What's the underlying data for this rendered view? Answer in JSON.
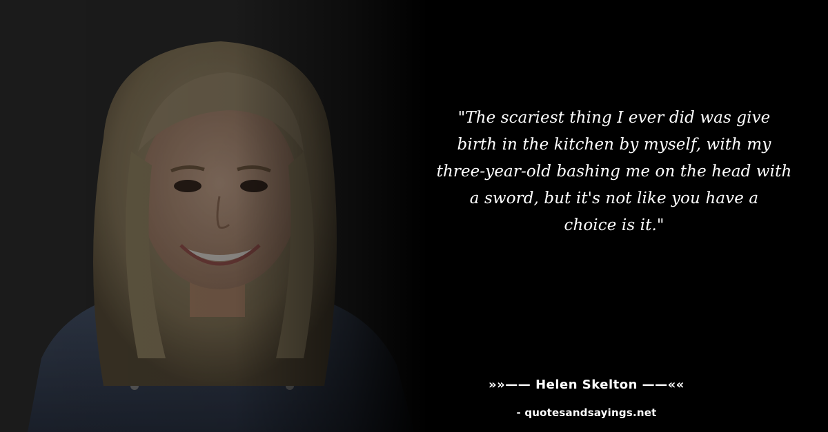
{
  "quote": {
    "text": "\"The scariest thing I ever did was give birth in the kitchen by myself, with my three-year-old bashing me on the head with a sword, but it's not like you have a choice is it.\"",
    "lines": [
      "\"The scariest thing I ever did was give",
      "birth in the kitchen by myself, with my",
      "three-year-old bashing me on the head with",
      "a sword, but it's not like you have a",
      "choice is it.\""
    ]
  },
  "author": {
    "line": "»»—— Helen Skelton ——««"
  },
  "source": {
    "line": "- quotesandsayings.net"
  },
  "photo": {
    "subject": "portrait-photo"
  },
  "colors": {
    "background": "#000000",
    "text": "#ffffff",
    "photo_backdrop": "#2b2b2b"
  }
}
